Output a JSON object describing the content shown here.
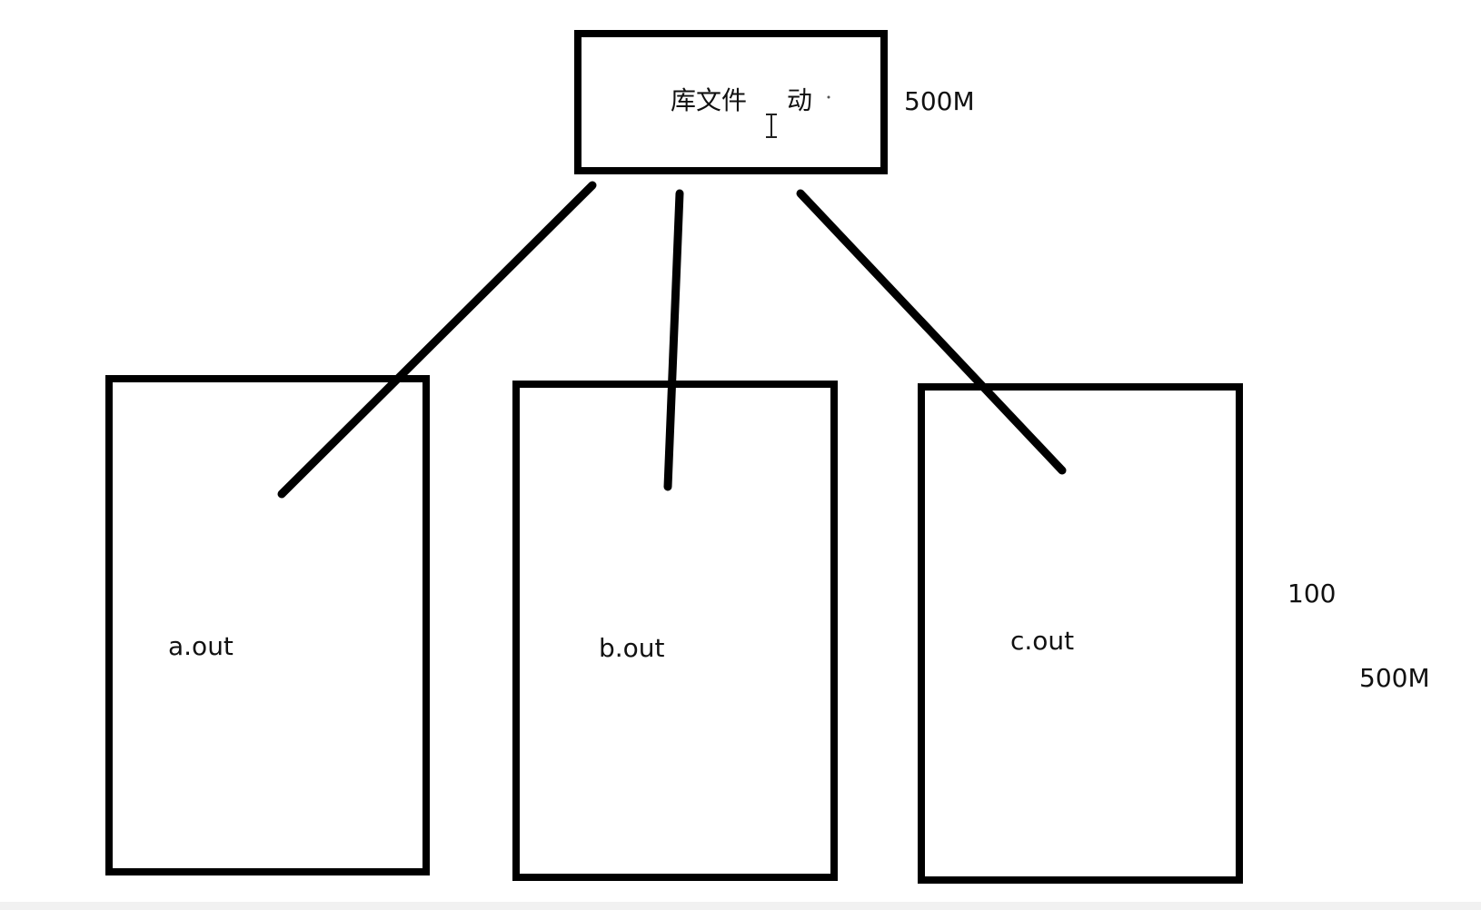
{
  "diagram": {
    "library_box": {
      "label": "库文件",
      "suffix": "动",
      "size": "500M"
    },
    "programs": [
      {
        "label": "a.out"
      },
      {
        "label": "b.out"
      },
      {
        "label": "c.out"
      }
    ],
    "side_notes": {
      "count": "100",
      "size": "500M"
    }
  }
}
